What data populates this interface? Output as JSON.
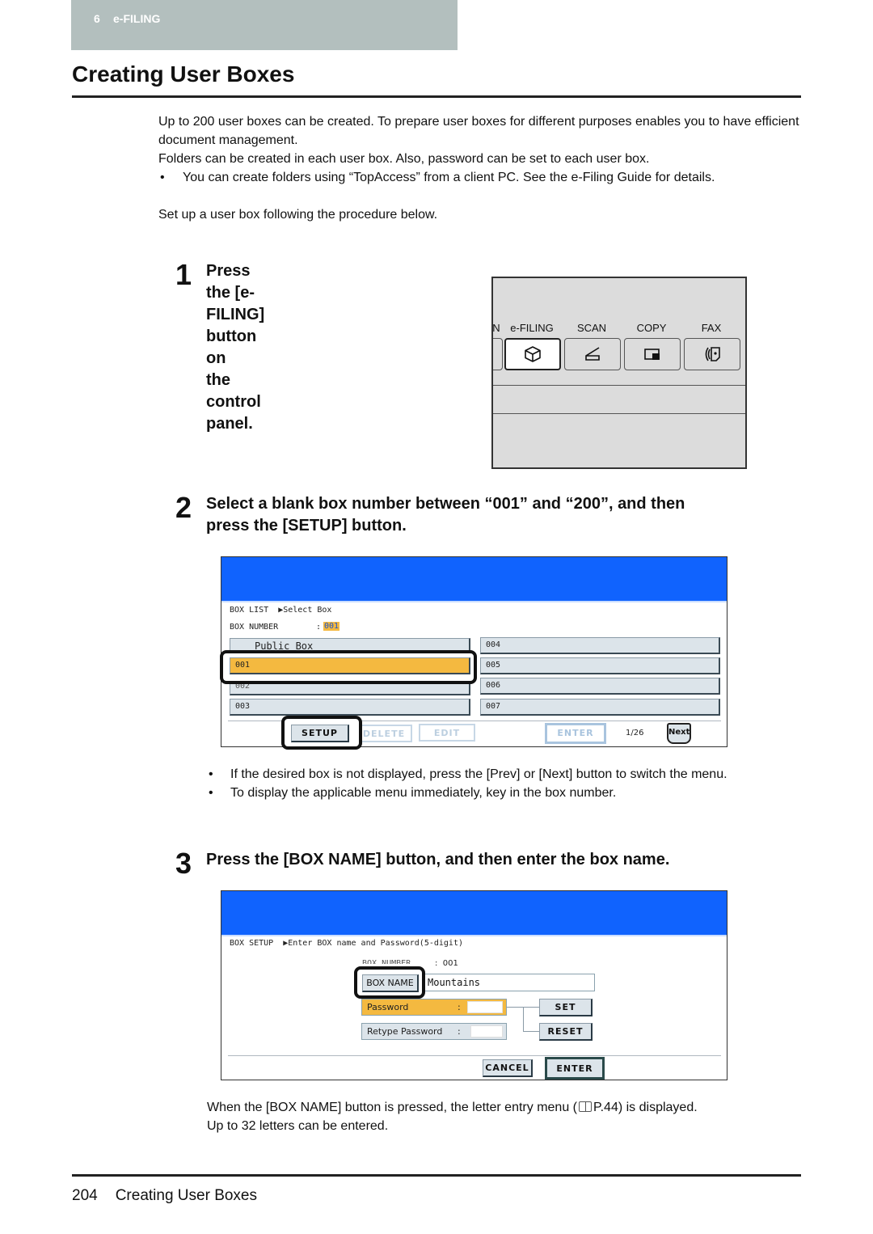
{
  "chapter": {
    "number": "6",
    "name": "e-FILING"
  },
  "page_title": "Creating User Boxes",
  "intro": {
    "p1": "Up to 200 user boxes can be created. To prepare user boxes for different purposes enables you to have efficient document management.",
    "p2": "Folders can be created in each user box. Also, password can be set to each user box.",
    "bullet1": "You can create folders using “TopAccess” from a client PC. See the e-Filing Guide for details.",
    "p3": "Set up a user box following the procedure below."
  },
  "steps": [
    {
      "number": "1",
      "line1": "Press the [e-FILING] button on",
      "line2": "the control panel."
    },
    {
      "number": "2",
      "line1": "Select a blank box number between “001” and “200”, and then",
      "line2": "press the [SETUP] button."
    },
    {
      "number": "3",
      "line1": "Press the [BOX NAME] button, and then enter the box name."
    }
  ],
  "control_panel": {
    "partial_label": "N",
    "buttons": [
      {
        "label": "e-FILING",
        "icon": "box-icon",
        "active": true
      },
      {
        "label": "SCAN",
        "icon": "scanner-icon",
        "active": false
      },
      {
        "label": "COPY",
        "icon": "copy-icon",
        "active": false
      },
      {
        "label": "FAX",
        "icon": "fax-icon",
        "active": false
      }
    ]
  },
  "screen_box_list": {
    "header_color": "#1063fe",
    "breadcrumb": "BOX LIST  ▶Select Box",
    "box_number_label": "BOX NUMBER",
    "box_number_sep": ":",
    "box_number_value": "001",
    "left_items": [
      "Public Box",
      "001",
      "002",
      "003"
    ],
    "right_items": [
      "004",
      "005",
      "006",
      "007"
    ],
    "selected_item": "001",
    "buttons": {
      "setup": "SETUP",
      "delete": "DELETE",
      "edit": "EDIT",
      "enter": "ENTER",
      "next": "Next"
    },
    "page_indicator": "1/26"
  },
  "screen_box_setup": {
    "header_color": "#1063fe",
    "breadcrumb": "BOX SETUP  ▶Enter BOX name and Password(5-digit)",
    "box_number_label": "BOX NUMBER",
    "box_number_value": ":  001",
    "box_name_button": "BOX NAME",
    "box_name_value": "Mountains",
    "password_label": "Password",
    "retype_label": "Retype Password",
    "colon": ":",
    "buttons": {
      "set": "SET",
      "reset": "RESET",
      "cancel": "CANCEL",
      "enter": "ENTER"
    }
  },
  "step2_notes": [
    "If the desired box is not displayed, press the [Prev] or [Next] button to switch the menu.",
    "To display the applicable menu immediately, key in the box number."
  ],
  "step3_desc": {
    "before": "When the [BOX NAME] button is pressed, the letter entry menu (",
    "ref": "P.44",
    "after": ") is displayed.",
    "line2": "Up to 32 letters can be entered."
  },
  "footer": {
    "page_number": "204",
    "title": "Creating User Boxes"
  },
  "colors": {
    "chapter_tab": "#b3bfbe",
    "selection_orange": "#f4b940",
    "screen_header_blue": "#1063fe"
  }
}
